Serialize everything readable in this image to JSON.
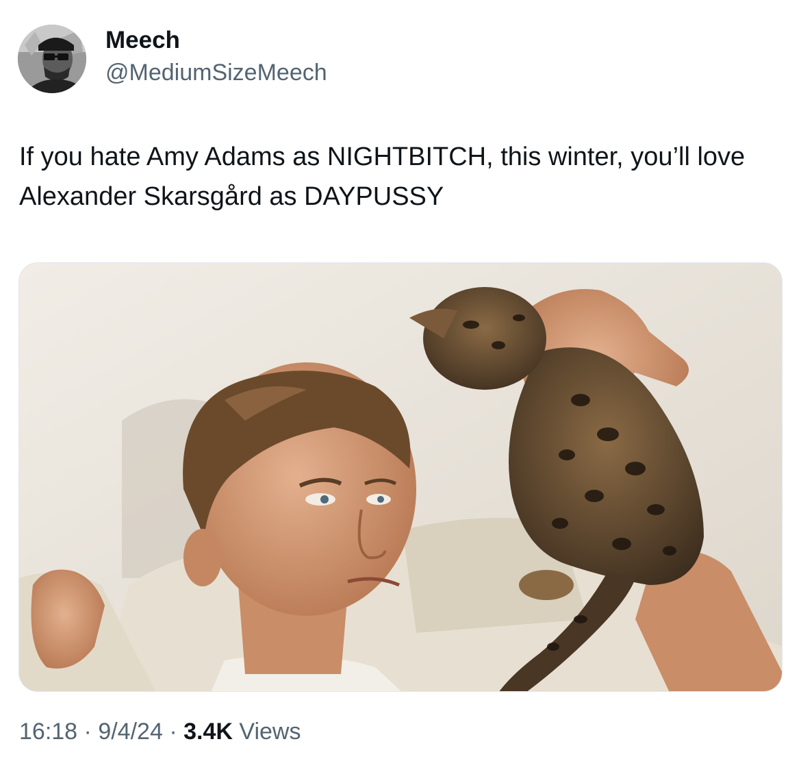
{
  "author": {
    "display_name": "Meech",
    "handle": "@MediumSizeMeech",
    "avatar_icon": "profile-photo"
  },
  "tweet": {
    "text": "If you hate Amy Adams as NIGHTBITCH, this winter, you’ll love Alexander Skarsgård as DAYPUSSY"
  },
  "meta": {
    "time": "16:18",
    "separator": "·",
    "date": "9/4/24",
    "views_count": "3.4K",
    "views_label": "Views"
  },
  "colors": {
    "text_primary": "#0f1419",
    "text_secondary": "#536471",
    "background": "#ffffff"
  }
}
